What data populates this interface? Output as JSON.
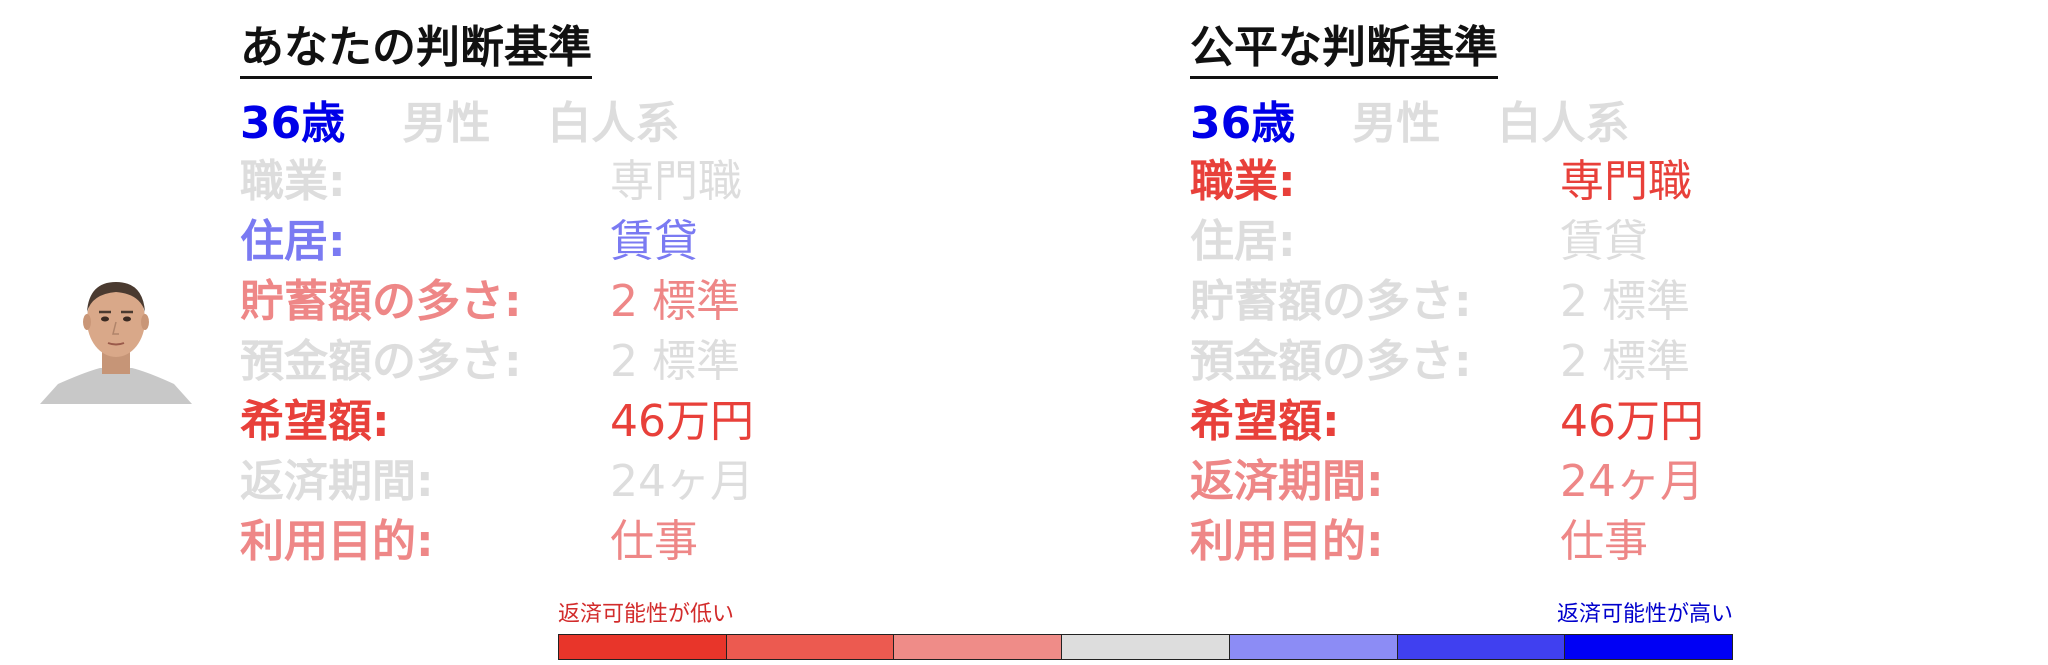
{
  "colors": {
    "gray": "#dddddd",
    "blue_strong": "#0000e8",
    "blue_light": "#7a7af2",
    "red_light": "#ee8787",
    "red_strong": "#e8403a",
    "text": "#111111"
  },
  "left": {
    "title": "あなたの判断基準",
    "age": "36歳",
    "gender": "男性",
    "ethnicity": "白人系",
    "rows": [
      {
        "label": "職業:",
        "value": "専門職",
        "color": "#dddddd"
      },
      {
        "label": "住居:",
        "value": "賃貸",
        "color": "#7a7af2"
      },
      {
        "label": "貯蓄額の多さ:",
        "value": "2 標準",
        "color": "#ee8787"
      },
      {
        "label": "預金額の多さ:",
        "value": "2 標準",
        "color": "#dddddd"
      },
      {
        "label": "希望額:",
        "value": "46万円",
        "color": "#e8403a"
      },
      {
        "label": "返済期間:",
        "value": "24ヶ月",
        "color": "#dddddd"
      },
      {
        "label": "利用目的:",
        "value": "仕事",
        "color": "#ee8787"
      }
    ]
  },
  "right": {
    "title": "公平な判断基準",
    "age": "36歳",
    "gender": "男性",
    "ethnicity": "白人系",
    "rows": [
      {
        "label": "職業:",
        "value": "専門職",
        "color": "#e8403a"
      },
      {
        "label": "住居:",
        "value": "賃貸",
        "color": "#dddddd"
      },
      {
        "label": "貯蓄額の多さ:",
        "value": "2 標準",
        "color": "#dddddd"
      },
      {
        "label": "預金額の多さ:",
        "value": "2 標準",
        "color": "#dddddd"
      },
      {
        "label": "希望額:",
        "value": "46万円",
        "color": "#e8403a"
      },
      {
        "label": "返済期間:",
        "value": "24ヶ月",
        "color": "#ee8787"
      },
      {
        "label": "利用目的:",
        "value": "仕事",
        "color": "#ee8787"
      }
    ]
  },
  "scale": {
    "low_label": "返済可能性が低い",
    "high_label": "返済可能性が高い",
    "low_color": "#d22b2b",
    "high_color": "#0000cc",
    "segments": [
      "#e8352a",
      "#ec5a50",
      "#ef8c88",
      "#dddddd",
      "#8c8cf5",
      "#4040f0",
      "#0000f5"
    ]
  }
}
